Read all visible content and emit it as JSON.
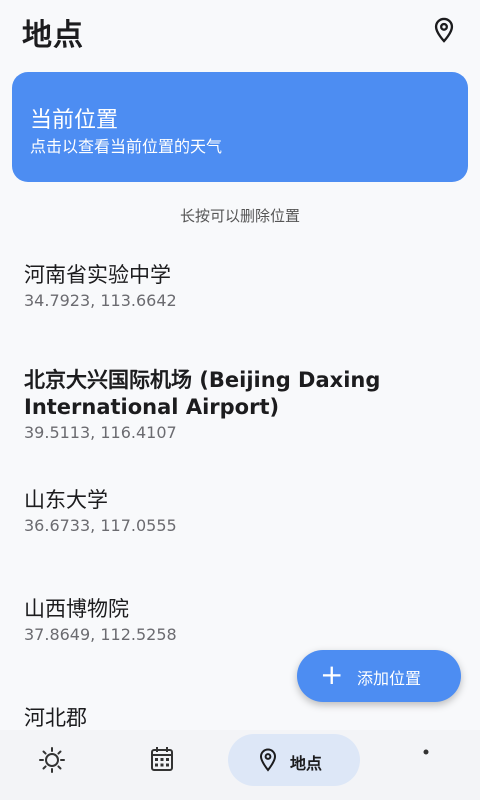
{
  "header": {
    "title": "地点"
  },
  "current_location": {
    "title": "当前位置",
    "subtitle": "点击以查看当前位置的天气"
  },
  "hint": "长按可以删除位置",
  "places": [
    {
      "name": "河南省实验中学",
      "coords": "34.7923, 113.6642"
    },
    {
      "name": "北京大兴国际机场 (Beijing Daxing International Airport)",
      "coords": "39.5113, 116.4107"
    },
    {
      "name": "山东大学",
      "coords": "36.6733, 117.0555"
    },
    {
      "name": "山西博物院",
      "coords": "37.8649, 112.5258"
    },
    {
      "name": "河北郡",
      "coords": ""
    }
  ],
  "fab": {
    "label": "添加位置",
    "icon": "plus-icon"
  },
  "nav": {
    "active_label": "地点"
  },
  "colors": {
    "accent": "#4d8df2",
    "nav_active_bg": "#dde7f7",
    "background": "#f8f9fb"
  }
}
